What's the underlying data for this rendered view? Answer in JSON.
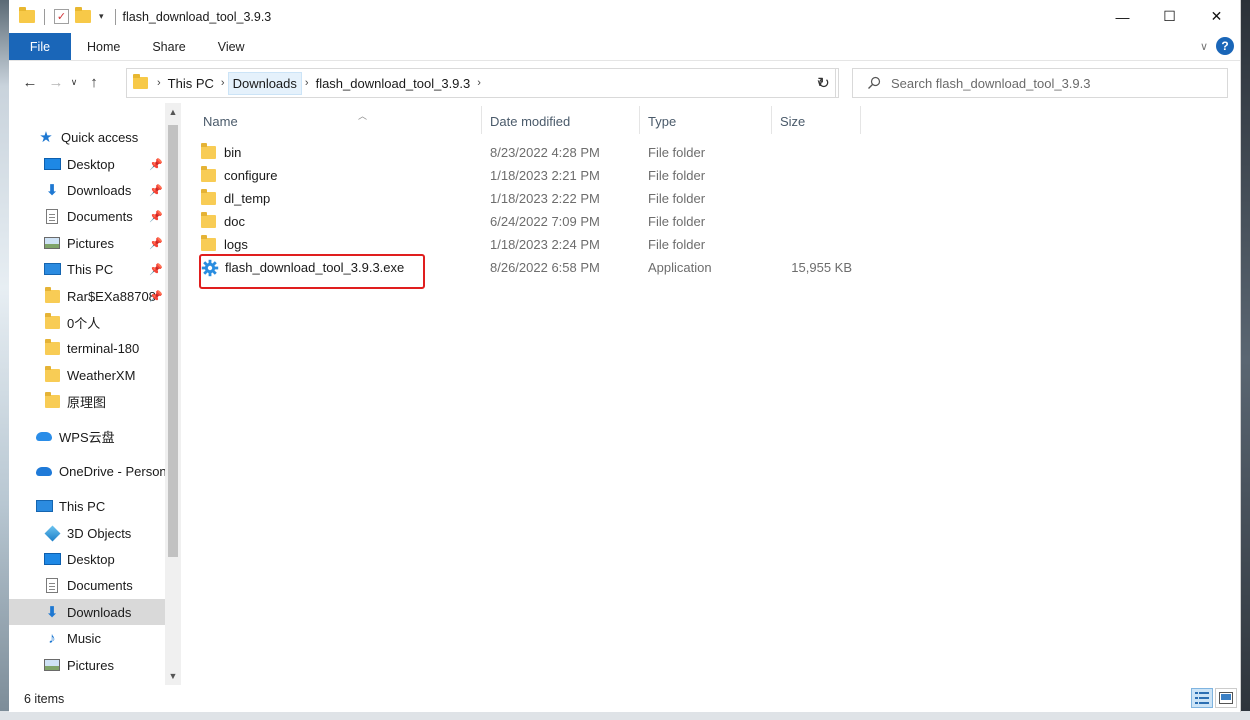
{
  "window": {
    "title": "flash_download_tool_3.9.3",
    "controls": {
      "minimize": "—",
      "maximize": "☐",
      "close": "✕"
    }
  },
  "ribbon": {
    "tabs": [
      "File",
      "Home",
      "Share",
      "View"
    ],
    "help": "?"
  },
  "address": {
    "crumbs": [
      "This PC",
      "Downloads",
      "flash_download_tool_3.9.3"
    ]
  },
  "search": {
    "placeholder": "Search flash_download_tool_3.9.3"
  },
  "nav": {
    "quick_access": "Quick access",
    "items": [
      {
        "label": "Desktop",
        "icon": "desktop-icon"
      },
      {
        "label": "Downloads",
        "icon": "downloads-icon"
      },
      {
        "label": "Documents",
        "icon": "documents-icon"
      },
      {
        "label": "Pictures",
        "icon": "pictures-icon"
      },
      {
        "label": "This PC",
        "icon": "this-pc-icon"
      },
      {
        "label": "Rar$EXa88708",
        "icon": "folder-icon"
      },
      {
        "label": "0个人",
        "icon": "folder-icon"
      },
      {
        "label": "terminal-180",
        "icon": "folder-icon"
      },
      {
        "label": "WeatherXM",
        "icon": "folder-icon"
      },
      {
        "label": "原理图",
        "icon": "folder-icon"
      }
    ],
    "wps": "WPS云盘",
    "onedrive": "OneDrive - Personal",
    "this_pc": "This PC",
    "pc_items": [
      {
        "label": "3D Objects",
        "icon": "3d-objects-icon"
      },
      {
        "label": "Desktop",
        "icon": "desktop-icon"
      },
      {
        "label": "Documents",
        "icon": "documents-icon"
      },
      {
        "label": "Downloads",
        "icon": "downloads-icon"
      },
      {
        "label": "Music",
        "icon": "music-icon"
      },
      {
        "label": "Pictures",
        "icon": "pictures-icon"
      }
    ]
  },
  "columns": {
    "name": "Name",
    "date": "Date modified",
    "type": "Type",
    "size": "Size"
  },
  "files": [
    {
      "name": "bin",
      "date": "8/23/2022 4:28 PM",
      "type": "File folder",
      "size": ""
    },
    {
      "name": "configure",
      "date": "1/18/2023 2:21 PM",
      "type": "File folder",
      "size": ""
    },
    {
      "name": "dl_temp",
      "date": "1/18/2023 2:22 PM",
      "type": "File folder",
      "size": ""
    },
    {
      "name": "doc",
      "date": "6/24/2022 7:09 PM",
      "type": "File folder",
      "size": ""
    },
    {
      "name": "logs",
      "date": "1/18/2023 2:24 PM",
      "type": "File folder",
      "size": ""
    },
    {
      "name": "flash_download_tool_3.9.3.exe",
      "date": "8/26/2022 6:58 PM",
      "type": "Application",
      "size": "15,955 KB"
    }
  ],
  "status": {
    "items": "6 items"
  },
  "colors": {
    "accent": "#1a66b8",
    "highlight": "#e01e1e",
    "folder": "#f8cc55"
  }
}
